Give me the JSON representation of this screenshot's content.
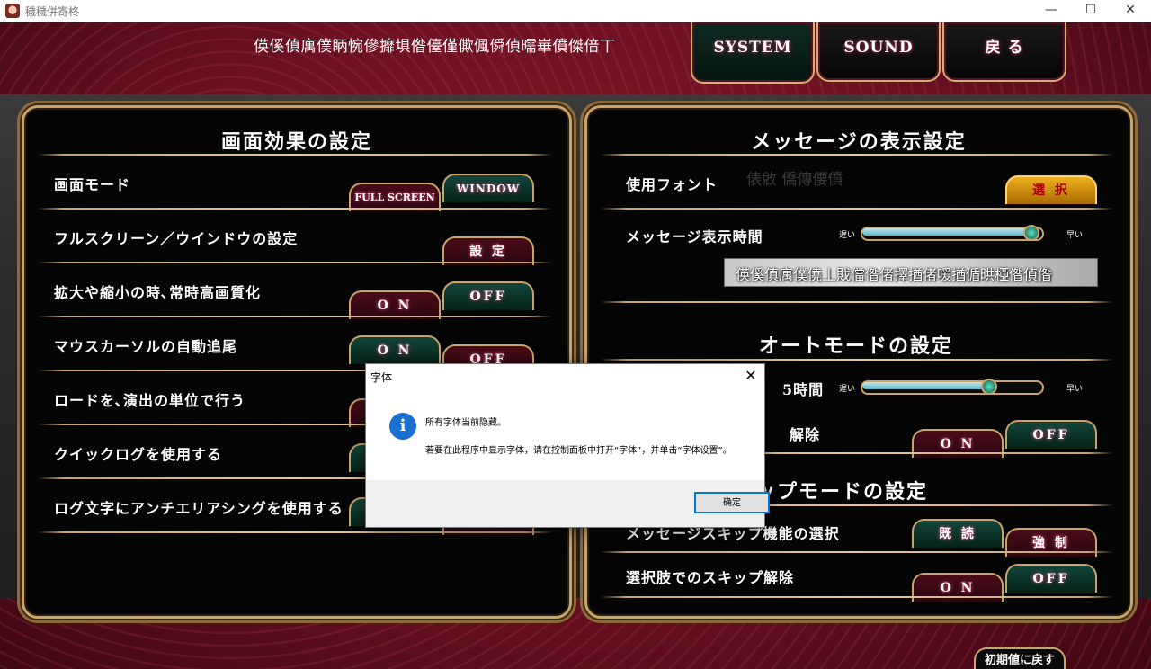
{
  "window": {
    "title": "穢穢併寄柊"
  },
  "window_controls": {
    "minimize": "—",
    "maximize": "☐",
    "close": "✕"
  },
  "top_text": "偀傒傎庽僕眪惋傪攠埧偺儓僅僛偑僢偵曘崋僨傑偣丅",
  "tabs": {
    "system": "SYSTEM",
    "sound": "SOUND",
    "back": "戻 る"
  },
  "left_panel": {
    "title": "画面効果の設定",
    "rows": [
      {
        "label": "画面モード",
        "buttons": [
          "FULL SCREEN",
          "WINDOW"
        ]
      },
      {
        "label": "フルスクリーン／ウインドウの設定",
        "buttons": [
          "設 定"
        ]
      },
      {
        "label": "拡大や縮小の時､常時高画質化",
        "buttons": [
          "O N",
          "OFF"
        ]
      },
      {
        "label": "マウスカーソルの自動追尾",
        "buttons": [
          "O N",
          "OFF"
        ]
      },
      {
        "label": "ロードを､演出の単位で行う"
      },
      {
        "label": "クイックログを使用する"
      },
      {
        "label": "ログ文字にアンチエリアシングを使用する"
      }
    ]
  },
  "right_panel": {
    "title": "メッセージの表示設定",
    "font_label": "使用フォント",
    "font_name": "俵敓 僑傳偠僨",
    "font_button": "選 択",
    "msg_speed_label": "メッセージ表示時間",
    "slow": "遅い",
    "fast": "早い",
    "msg_speed_value": 0.96,
    "preview_text": "偀傒傎庽僕僥丄戝儅偺偖擇揂偖喛揂偱晎椏偺偵偺",
    "auto_title": "オートモードの設定",
    "auto_time_label": "5時間",
    "auto_time_value": 0.72,
    "auto_release_label": "解除",
    "auto_release_buttons": [
      "O N",
      "OFF"
    ],
    "skip_title": "ップモードの設定",
    "skip_select_label": "メッセージスキップ機能の選択",
    "skip_select_buttons": [
      "既 読",
      "強 制"
    ],
    "choice_skip_label": "選択肢でのスキップ解除",
    "choice_skip_buttons": [
      "O N",
      "OFF"
    ]
  },
  "reset_button": "初期値に戻す",
  "dialog": {
    "title": "字体",
    "icon": "i",
    "message1": "所有字体当前隐藏。",
    "message2": "若要在此程序中显示字体，请在控制面板中打开“字体”，并单击“字体设置”。",
    "ok": "确定",
    "close": "✕"
  }
}
